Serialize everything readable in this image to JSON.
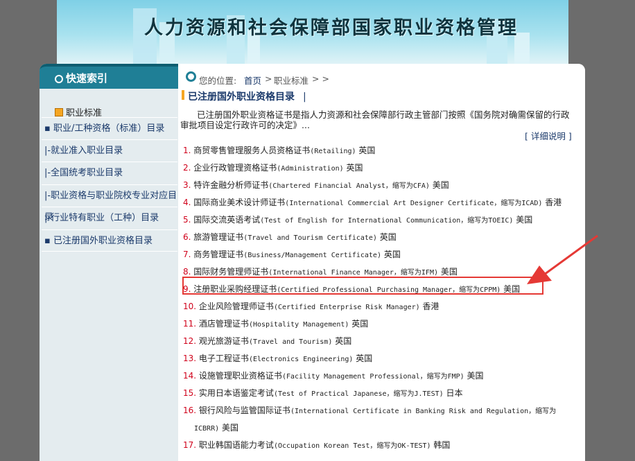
{
  "banner": {
    "title": "人力资源和社会保障部国家职业资格管理"
  },
  "sidebar": {
    "header": "快速索引",
    "sub_label": "职业标准",
    "items": [
      {
        "label": "▪ 职业/工种资格（标准）目录"
      },
      {
        "label": "|-就业准入职业目录"
      },
      {
        "label": "|-全国统考职业目录"
      },
      {
        "label": "|-职业资格与职业院校专业对应目录"
      },
      {
        "label": "|-行业特有职业（工种）目录"
      },
      {
        "label": "▪ 已注册国外职业资格目录"
      }
    ]
  },
  "breadcrumb": {
    "label": "您的位置:",
    "home": "首页",
    "sep": ">",
    "current": "职业标准",
    "tail": "> >"
  },
  "section": {
    "title": "已注册国外职业资格目录",
    "pipe": "|",
    "intro": "已注册国外职业资格证书是指人力资源和社会保障部行政主管部门按照《国务院对确需保留的行政审批项目设定行政许可的决定》...",
    "detail_link": "[ 详细说明 ]"
  },
  "list": [
    {
      "num": "1.",
      "cn": "商贸零售管理服务人员资格证书",
      "en": "(Retailing)",
      "country": "英国"
    },
    {
      "num": "2.",
      "cn": "企业行政管理资格证书",
      "en": "(Administration)",
      "country": "英国"
    },
    {
      "num": "3.",
      "cn": "特许金融分析师证书",
      "en": "(Chartered Financial Analyst，缩写为CFA)",
      "country": "美国"
    },
    {
      "num": "4.",
      "cn": "国际商业美术设计师证书",
      "en": "(International Commercial Art Designer Certificate，缩写为ICAD)",
      "country": "香港"
    },
    {
      "num": "5.",
      "cn": "国际交流英语考试",
      "en": "(Test of English for International Communication，缩写为TOEIC)",
      "country": "美国"
    },
    {
      "num": "6.",
      "cn": "旅游管理证书",
      "en": "(Travel and Tourism Certificate)",
      "country": "英国"
    },
    {
      "num": "7.",
      "cn": "商务管理证书",
      "en": "(Business/Management Certificate)",
      "country": "英国"
    },
    {
      "num": "8.",
      "cn": "国际财务管理师证书",
      "en": "(International Finance Manager，缩写为IFM)",
      "country": "美国"
    },
    {
      "num": "9.",
      "cn": "注册职业采购经理证书",
      "en": "(Certified Professional Purchasing Manager，缩写为CPPM)",
      "country": "美国"
    },
    {
      "num": "10.",
      "cn": "企业风险管理师证书",
      "en": "(Certified Enterprise Risk Manager)",
      "country": "香港"
    },
    {
      "num": "11.",
      "cn": "酒店管理证书",
      "en": "(Hospitality Management)",
      "country": "英国"
    },
    {
      "num": "12.",
      "cn": "观光旅游证书",
      "en": "(Travel and Tourism)",
      "country": "英国"
    },
    {
      "num": "13.",
      "cn": "电子工程证书",
      "en": "(Electronics Engineering)",
      "country": "英国"
    },
    {
      "num": "14.",
      "cn": "设施管理职业资格证书",
      "en": "(Facility Management Professional，缩写为FMP)",
      "country": "美国"
    },
    {
      "num": "15.",
      "cn": "实用日本语鉴定考试",
      "en": "(Test of Practical Japanese，缩写为J.TEST)",
      "country": "日本"
    },
    {
      "num": "16.",
      "cn": "银行风险与监管国际证书",
      "en": "(International Certificate in Banking Risk and Regulation，缩写为",
      "cont_en": "ICBRR)",
      "country": "美国"
    },
    {
      "num": "17.",
      "cn": "职业韩国语能力考试",
      "en": "(Occupation Korean Test，缩写为OK-TEST)",
      "country": "韩国"
    }
  ],
  "colors": {
    "accent": "#1f7f96",
    "highlight": "#e53935",
    "number": "#d0021b"
  }
}
